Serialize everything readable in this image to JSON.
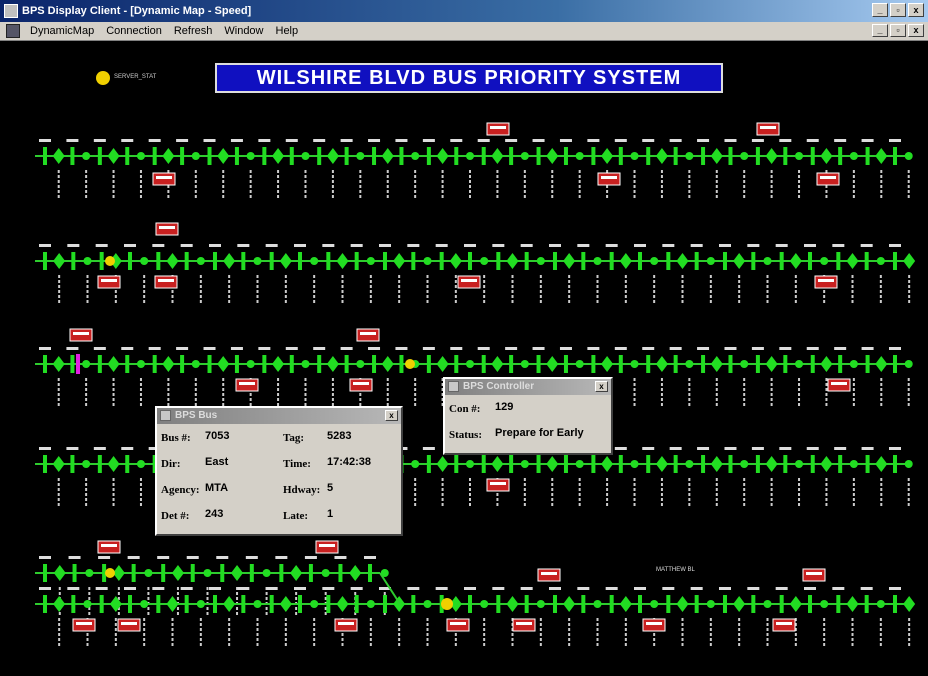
{
  "window": {
    "title": "BPS Display Client - [Dynamic Map - Speed]",
    "min": "_",
    "max": "▫",
    "close": "x"
  },
  "menu": [
    "DynamicMap",
    "Connection",
    "Refresh",
    "Window",
    "Help"
  ],
  "map": {
    "banner": "WILSHIRE BLVD BUS PRIORITY SYSTEM",
    "status_label": "SERVER_STAT",
    "street_label": "MATTHEW BL"
  },
  "bus_dialog": {
    "title": "BPS Bus",
    "close": "x",
    "fields": [
      {
        "label": "Bus #:",
        "value": "7053"
      },
      {
        "label": "Tag:",
        "value": "5283"
      },
      {
        "label": "Dir:",
        "value": "East"
      },
      {
        "label": "Time:",
        "value": "17:42:38"
      },
      {
        "label": "Agency:",
        "value": "MTA"
      },
      {
        "label": "Hdway:",
        "value": "5"
      },
      {
        "label": "Det #:",
        "value": "243"
      },
      {
        "label": "Late:",
        "value": "1"
      }
    ]
  },
  "controller_dialog": {
    "title": "BPS Controller",
    "close": "x",
    "fields": [
      {
        "label": "Con #:",
        "value": "129"
      },
      {
        "label": "Status:",
        "value": "Prepare for Early"
      }
    ]
  },
  "colors": {
    "track": "#2ecc2e",
    "signal": "#22dd22",
    "highlight": "#f0d000",
    "alert": "#e020e0",
    "bus": "#c82020",
    "banner": "#1010c0"
  }
}
